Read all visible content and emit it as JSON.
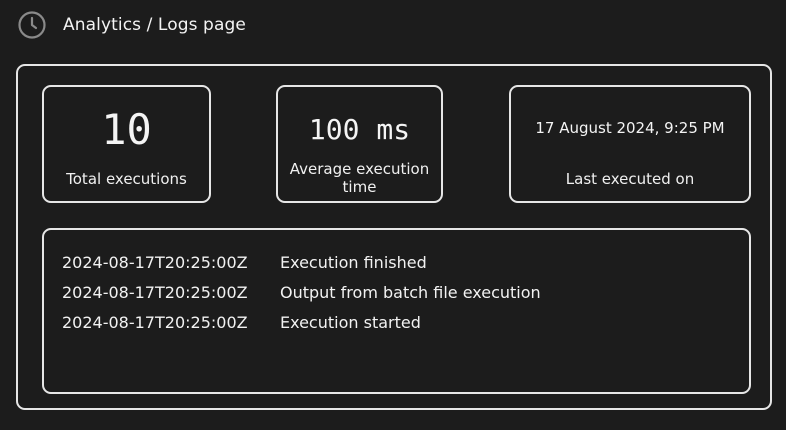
{
  "header": {
    "title": "Analytics / Logs page",
    "icon": "clock-icon"
  },
  "stats": {
    "total_executions": {
      "value": "10",
      "label": "Total executions"
    },
    "average_execution_time": {
      "value": "100 ms",
      "label": "Average execution time"
    },
    "last_executed": {
      "value": "17 August 2024, 9:25 PM",
      "label": "Last executed on"
    }
  },
  "logs": [
    {
      "timestamp": "2024-08-17T20:25:00Z",
      "message": "Execution finished"
    },
    {
      "timestamp": "2024-08-17T20:25:00Z",
      "message": "Output from batch file execution"
    },
    {
      "timestamp": "2024-08-17T20:25:00Z",
      "message": "Execution started"
    }
  ],
  "colors": {
    "background": "#1c1c1c",
    "border": "#e6e6e6",
    "text": "#f2f2f2"
  }
}
